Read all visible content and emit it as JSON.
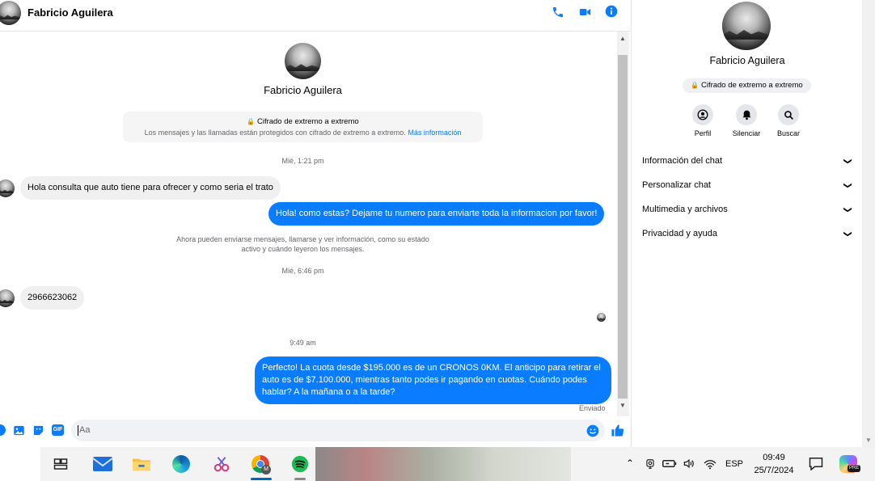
{
  "header": {
    "name": "Fabricio Aguilera"
  },
  "profile": {
    "name": "Fabricio Aguilera"
  },
  "encryption": {
    "title": "Cifrado de extremo a extremo",
    "body": "Los mensajes y las llamadas están protegidos con cifrado de extremo a extremo.",
    "link": "Más información"
  },
  "messages": {
    "ts1": "Mié, 1:21 pm",
    "m1": "Hola consulta que auto tiene para ofrecer y como seria el trato",
    "m2": "Hola! como estas? Dejame tu numero para enviarte toda la informacion por favor!",
    "notice_l1": "Ahora pueden enviarse mensajes, llamarse y ver información, como su estado",
    "notice_l2": "activo y cuándo leyeron los mensajes.",
    "ts2": "Mié, 6:46 pm",
    "m3": "2966623062",
    "ts3": "9:49 am",
    "m4": "Perfecto! La cuota desde $195.000 es de un CRONOS 0KM. El anticipo para retirar el auto es de $7.100.000, mientras tanto podes ir pagando en cuotas. Cuándo podes hablar? A la mañana o a la tarde?",
    "status": "Enviado"
  },
  "composer": {
    "placeholder": "Aa"
  },
  "right_panel": {
    "name": "Fabricio Aguilera",
    "badge": "Cifrado de extremo a extremo",
    "actions": [
      "Perfil",
      "Silenciar",
      "Buscar"
    ],
    "sections": [
      "Información del chat",
      "Personalizar chat",
      "Multimedia y archivos",
      "Privacidad y ayuda"
    ]
  },
  "taskbar": {
    "lang": "ESP",
    "time": "09:49",
    "date": "25/7/2024",
    "chrome_badge": "M",
    "copilot_badge": "PRE"
  },
  "colors": {
    "accent": "#0a7cff",
    "bubble_in": "#f0f0f0",
    "taskbar": "#f3f3f3"
  }
}
